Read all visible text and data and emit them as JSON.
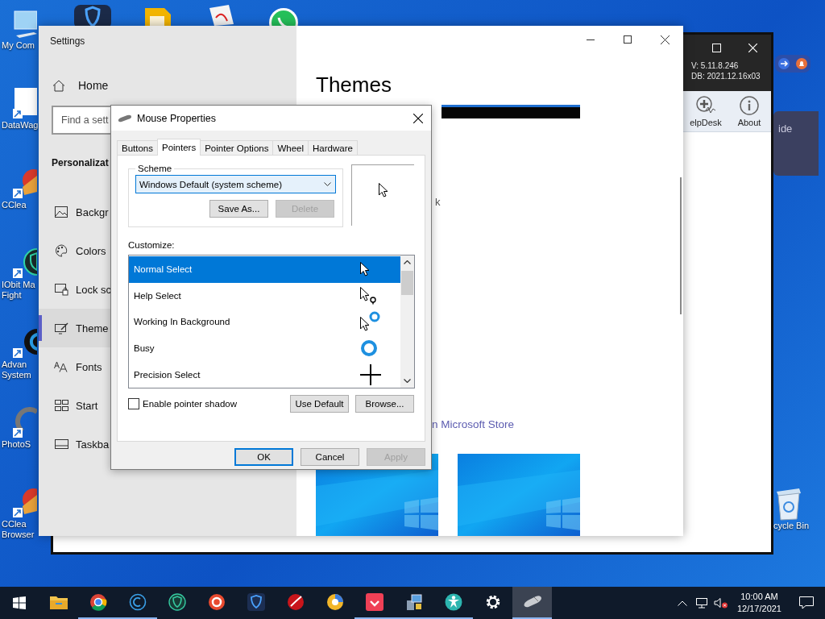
{
  "desktop_icons": [
    {
      "kind": "computer",
      "lines": [
        "My Com"
      ]
    },
    {
      "kind": "file",
      "lines": [
        "DataWag"
      ]
    },
    {
      "kind": "ccleaner",
      "lines": [
        "CClea"
      ]
    },
    {
      "kind": "shield",
      "lines": [
        "IObit Ma",
        "Fight"
      ]
    },
    {
      "kind": "advanced",
      "lines": [
        "Advan",
        "System"
      ]
    },
    {
      "lines": [
        "PhotoS"
      ]
    },
    {
      "kind": "ccleaner",
      "lines": [
        "CClea",
        "Browser"
      ]
    }
  ],
  "recycle_bin": {
    "label": "cycle Bin"
  },
  "back_window": {
    "version": "V: 5.11.8.246",
    "db": "DB: 2021.12.16x03",
    "tools": [
      {
        "kind": "helpdesk",
        "label": "elpDesk"
      },
      {
        "kind": "about",
        "label": "About"
      }
    ]
  },
  "notification": {
    "text": "ide"
  },
  "settings": {
    "title": "Settings",
    "home": "Home",
    "search": {
      "placeholder": "Find a sett"
    },
    "section": "Personalizat",
    "items": [
      {
        "kind": "background",
        "label": "Backgr",
        "selected": false
      },
      {
        "kind": "colors",
        "label": "Colors",
        "selected": false
      },
      {
        "kind": "lock",
        "label": "Lock sc",
        "selected": false
      },
      {
        "kind": "themes",
        "label": "Theme",
        "selected": true
      },
      {
        "kind": "fonts",
        "label": "Fonts",
        "selected": false
      },
      {
        "kind": "start",
        "label": "Start",
        "selected": false
      },
      {
        "kind": "taskbar",
        "label": "Taskba",
        "selected": false
      }
    ],
    "heading": "Themes",
    "fragment": "k",
    "store_link": "n Microsoft Store"
  },
  "dialog": {
    "title": "Mouse Properties",
    "tabs": [
      {
        "label": "Buttons",
        "selected": false
      },
      {
        "label": "Pointers",
        "selected": true
      },
      {
        "label": "Pointer Options",
        "selected": false
      },
      {
        "label": "Wheel",
        "selected": false
      },
      {
        "label": "Hardware",
        "selected": false
      }
    ],
    "scheme": {
      "legend": "Scheme",
      "value": "Windows Default (system scheme)",
      "buttons": [
        {
          "label": "Save As...",
          "disabled": false
        },
        {
          "label": "Delete",
          "disabled": true
        }
      ]
    },
    "customize_label": "Customize:",
    "pointers": [
      {
        "kind": "arrow",
        "label": "Normal Select",
        "selected": true
      },
      {
        "kind": "help",
        "label": "Help Select",
        "selected": false
      },
      {
        "kind": "working",
        "label": "Working In Background",
        "selected": false
      },
      {
        "kind": "busy",
        "label": "Busy",
        "selected": false
      },
      {
        "kind": "precision",
        "label": "Precision Select",
        "selected": false
      }
    ],
    "shadow": {
      "label": "Enable pointer shadow",
      "checked": false
    },
    "list_buttons": [
      {
        "label": "Use Default",
        "disabled": false
      },
      {
        "label": "Browse...",
        "disabled": false
      }
    ],
    "footer_buttons": [
      {
        "label": "OK",
        "default": true,
        "disabled": false
      },
      {
        "label": "Cancel",
        "default": false,
        "disabled": false
      },
      {
        "label": "Apply",
        "default": false,
        "disabled": true
      }
    ]
  },
  "taskbar": {
    "apps": [
      {
        "kind": "folder",
        "running": false,
        "active": false
      },
      {
        "kind": "chrome",
        "running": true,
        "active": false
      },
      {
        "kind": "ring",
        "running": true,
        "active": false
      },
      {
        "kind": "greenshield",
        "running": false,
        "active": false
      },
      {
        "kind": "redc",
        "running": false,
        "active": false
      },
      {
        "kind": "blueshield",
        "running": false,
        "active": false
      },
      {
        "kind": "swoosh",
        "running": false,
        "active": false
      },
      {
        "kind": "globe",
        "running": false,
        "active": false
      },
      {
        "kind": "pocket",
        "running": true,
        "active": false
      },
      {
        "kind": "network",
        "running": true,
        "active": false
      },
      {
        "kind": "figure",
        "running": true,
        "active": false
      },
      {
        "kind": "gear",
        "running": false,
        "active": false
      },
      {
        "kind": "mouse",
        "running": true,
        "active": true
      }
    ],
    "clock": {
      "time": "10:00 AM",
      "date": "12/17/2021"
    }
  }
}
